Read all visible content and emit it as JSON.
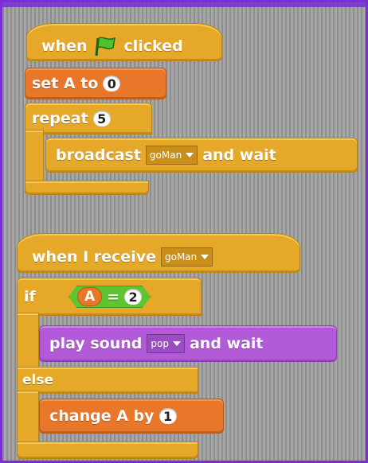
{
  "script1": {
    "hat": {
      "when": "when",
      "clicked": "clicked"
    },
    "set": {
      "label": "set A to",
      "value": "0"
    },
    "repeat": {
      "label": "repeat",
      "value": "5"
    },
    "broadcast": {
      "label": "broadcast",
      "message": "goMan",
      "suffix": "and wait"
    }
  },
  "script2": {
    "hat": {
      "label": "when I receive",
      "message": "goMan"
    },
    "if": {
      "label": "if",
      "var": "A",
      "op": "=",
      "value": "2"
    },
    "play": {
      "label": "play sound",
      "sound": "pop",
      "suffix": "and wait"
    },
    "else": {
      "label": "else"
    },
    "change": {
      "label": "change A by",
      "value": "1"
    }
  }
}
